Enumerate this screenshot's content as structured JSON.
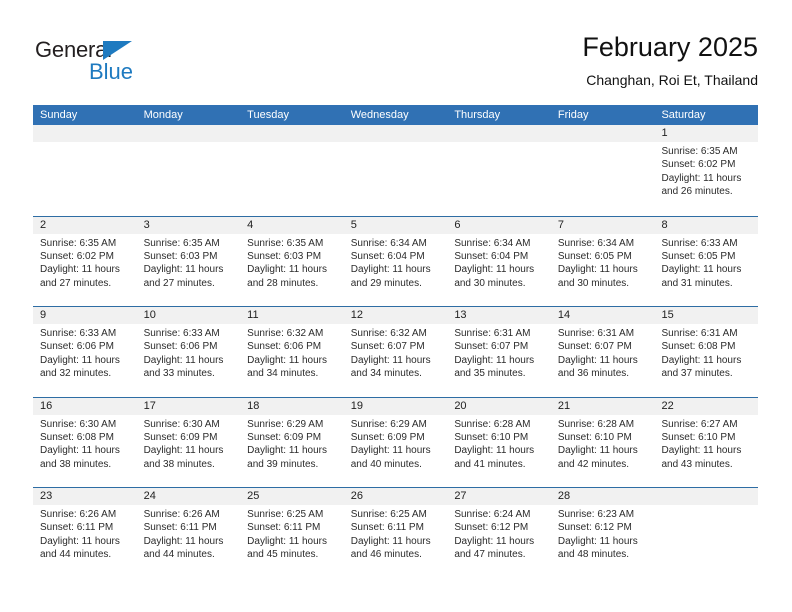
{
  "brand": {
    "name_top": "General",
    "name_bottom": "Blue",
    "triangle_icon": "triangle-icon",
    "accent_color": "#1e7ac0"
  },
  "header": {
    "month_title": "February 2025",
    "location": "Changhan, Roi Et, Thailand"
  },
  "theme": {
    "header_blue": "#3071b4",
    "row_divider": "#2e6da4",
    "daynum_band": "#f1f1f1"
  },
  "calendar": {
    "weekday_headers": [
      "Sunday",
      "Monday",
      "Tuesday",
      "Wednesday",
      "Thursday",
      "Friday",
      "Saturday"
    ],
    "labels": {
      "sunrise": "Sunrise:",
      "sunset": "Sunset:",
      "daylight": "Daylight:"
    },
    "weeks": [
      [
        {
          "empty": true
        },
        {
          "empty": true
        },
        {
          "empty": true
        },
        {
          "empty": true
        },
        {
          "empty": true
        },
        {
          "empty": true
        },
        {
          "day": "1",
          "sunrise": "Sunrise: 6:35 AM",
          "sunset": "Sunset: 6:02 PM",
          "daylight": "Daylight: 11 hours and 26 minutes."
        }
      ],
      [
        {
          "day": "2",
          "sunrise": "Sunrise: 6:35 AM",
          "sunset": "Sunset: 6:02 PM",
          "daylight": "Daylight: 11 hours and 27 minutes."
        },
        {
          "day": "3",
          "sunrise": "Sunrise: 6:35 AM",
          "sunset": "Sunset: 6:03 PM",
          "daylight": "Daylight: 11 hours and 27 minutes."
        },
        {
          "day": "4",
          "sunrise": "Sunrise: 6:35 AM",
          "sunset": "Sunset: 6:03 PM",
          "daylight": "Daylight: 11 hours and 28 minutes."
        },
        {
          "day": "5",
          "sunrise": "Sunrise: 6:34 AM",
          "sunset": "Sunset: 6:04 PM",
          "daylight": "Daylight: 11 hours and 29 minutes."
        },
        {
          "day": "6",
          "sunrise": "Sunrise: 6:34 AM",
          "sunset": "Sunset: 6:04 PM",
          "daylight": "Daylight: 11 hours and 30 minutes."
        },
        {
          "day": "7",
          "sunrise": "Sunrise: 6:34 AM",
          "sunset": "Sunset: 6:05 PM",
          "daylight": "Daylight: 11 hours and 30 minutes."
        },
        {
          "day": "8",
          "sunrise": "Sunrise: 6:33 AM",
          "sunset": "Sunset: 6:05 PM",
          "daylight": "Daylight: 11 hours and 31 minutes."
        }
      ],
      [
        {
          "day": "9",
          "sunrise": "Sunrise: 6:33 AM",
          "sunset": "Sunset: 6:06 PM",
          "daylight": "Daylight: 11 hours and 32 minutes."
        },
        {
          "day": "10",
          "sunrise": "Sunrise: 6:33 AM",
          "sunset": "Sunset: 6:06 PM",
          "daylight": "Daylight: 11 hours and 33 minutes."
        },
        {
          "day": "11",
          "sunrise": "Sunrise: 6:32 AM",
          "sunset": "Sunset: 6:06 PM",
          "daylight": "Daylight: 11 hours and 34 minutes."
        },
        {
          "day": "12",
          "sunrise": "Sunrise: 6:32 AM",
          "sunset": "Sunset: 6:07 PM",
          "daylight": "Daylight: 11 hours and 34 minutes."
        },
        {
          "day": "13",
          "sunrise": "Sunrise: 6:31 AM",
          "sunset": "Sunset: 6:07 PM",
          "daylight": "Daylight: 11 hours and 35 minutes."
        },
        {
          "day": "14",
          "sunrise": "Sunrise: 6:31 AM",
          "sunset": "Sunset: 6:07 PM",
          "daylight": "Daylight: 11 hours and 36 minutes."
        },
        {
          "day": "15",
          "sunrise": "Sunrise: 6:31 AM",
          "sunset": "Sunset: 6:08 PM",
          "daylight": "Daylight: 11 hours and 37 minutes."
        }
      ],
      [
        {
          "day": "16",
          "sunrise": "Sunrise: 6:30 AM",
          "sunset": "Sunset: 6:08 PM",
          "daylight": "Daylight: 11 hours and 38 minutes."
        },
        {
          "day": "17",
          "sunrise": "Sunrise: 6:30 AM",
          "sunset": "Sunset: 6:09 PM",
          "daylight": "Daylight: 11 hours and 38 minutes."
        },
        {
          "day": "18",
          "sunrise": "Sunrise: 6:29 AM",
          "sunset": "Sunset: 6:09 PM",
          "daylight": "Daylight: 11 hours and 39 minutes."
        },
        {
          "day": "19",
          "sunrise": "Sunrise: 6:29 AM",
          "sunset": "Sunset: 6:09 PM",
          "daylight": "Daylight: 11 hours and 40 minutes."
        },
        {
          "day": "20",
          "sunrise": "Sunrise: 6:28 AM",
          "sunset": "Sunset: 6:10 PM",
          "daylight": "Daylight: 11 hours and 41 minutes."
        },
        {
          "day": "21",
          "sunrise": "Sunrise: 6:28 AM",
          "sunset": "Sunset: 6:10 PM",
          "daylight": "Daylight: 11 hours and 42 minutes."
        },
        {
          "day": "22",
          "sunrise": "Sunrise: 6:27 AM",
          "sunset": "Sunset: 6:10 PM",
          "daylight": "Daylight: 11 hours and 43 minutes."
        }
      ],
      [
        {
          "day": "23",
          "sunrise": "Sunrise: 6:26 AM",
          "sunset": "Sunset: 6:11 PM",
          "daylight": "Daylight: 11 hours and 44 minutes."
        },
        {
          "day": "24",
          "sunrise": "Sunrise: 6:26 AM",
          "sunset": "Sunset: 6:11 PM",
          "daylight": "Daylight: 11 hours and 44 minutes."
        },
        {
          "day": "25",
          "sunrise": "Sunrise: 6:25 AM",
          "sunset": "Sunset: 6:11 PM",
          "daylight": "Daylight: 11 hours and 45 minutes."
        },
        {
          "day": "26",
          "sunrise": "Sunrise: 6:25 AM",
          "sunset": "Sunset: 6:11 PM",
          "daylight": "Daylight: 11 hours and 46 minutes."
        },
        {
          "day": "27",
          "sunrise": "Sunrise: 6:24 AM",
          "sunset": "Sunset: 6:12 PM",
          "daylight": "Daylight: 11 hours and 47 minutes."
        },
        {
          "day": "28",
          "sunrise": "Sunrise: 6:23 AM",
          "sunset": "Sunset: 6:12 PM",
          "daylight": "Daylight: 11 hours and 48 minutes."
        },
        {
          "empty": true
        }
      ]
    ]
  }
}
